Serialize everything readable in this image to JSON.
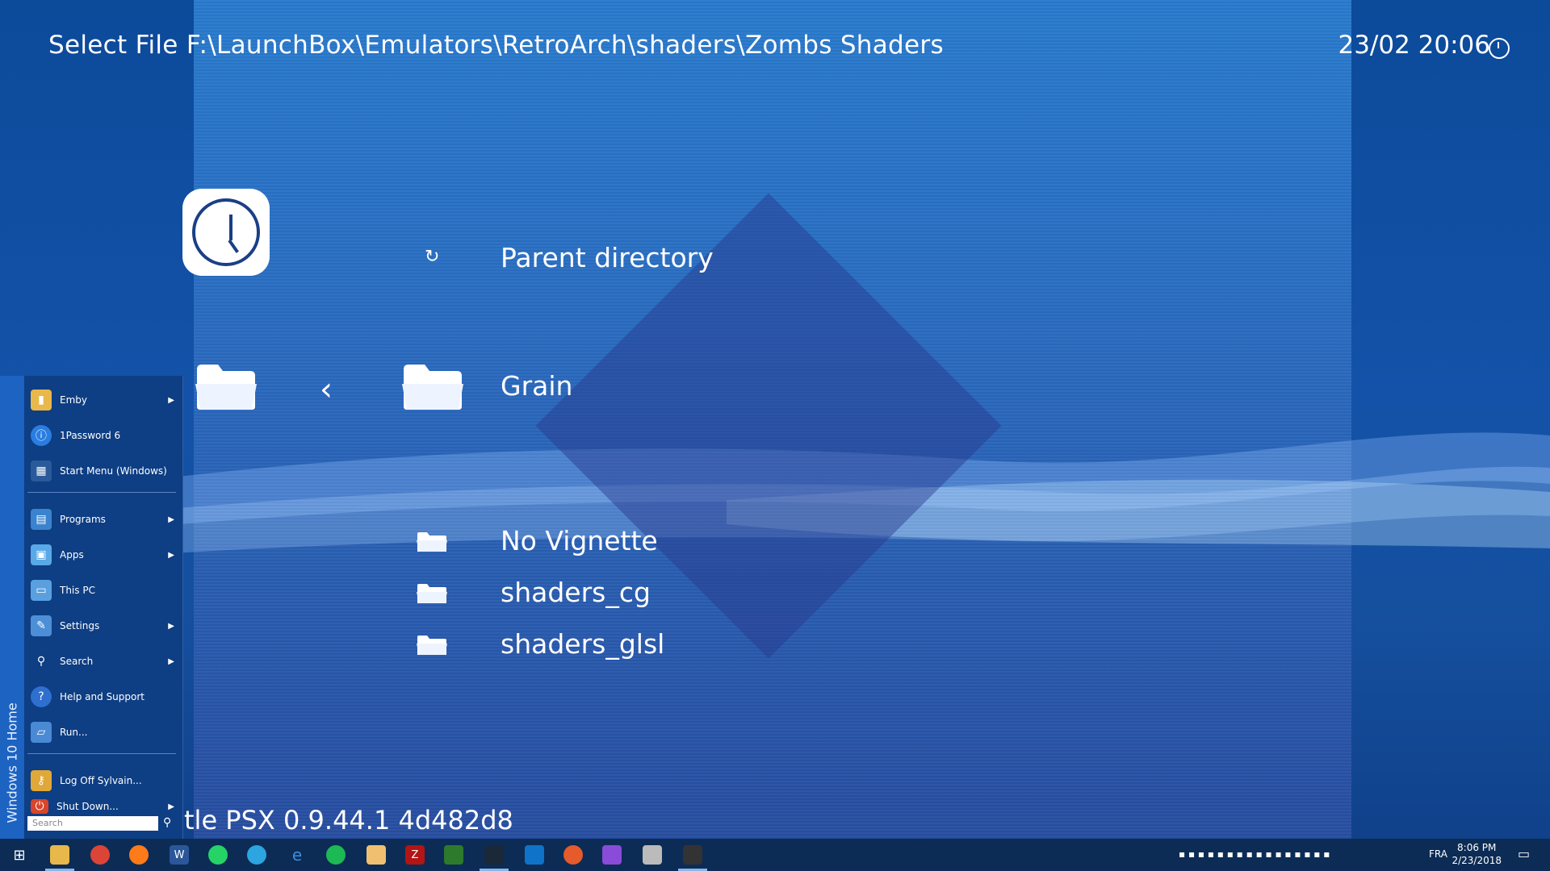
{
  "header": {
    "title": "Select File F:\\LaunchBox\\Emulators\\RetroArch\\shaders\\Zombs Shaders",
    "clock": "23/02 20:06"
  },
  "entries": {
    "parent": "Parent directory",
    "grain": "Grain",
    "no_vignette": "No Vignette",
    "shaders_cg": "shaders_cg",
    "shaders_glsl": "shaders_glsl"
  },
  "footer": {
    "core": "tle PSX 0.9.44.1 4d482d8"
  },
  "startmenu": {
    "stripe": "Windows 10 Home",
    "items": [
      "Emby",
      "1Password 6",
      "Start Menu (Windows)",
      "Programs",
      "Apps",
      "This PC",
      "Settings",
      "Search",
      "Help and Support",
      "Run...",
      "Log Off Sylvain...",
      "Shut Down..."
    ],
    "search_placeholder": "Search"
  },
  "taskbar": {
    "lang": "FRA",
    "time": "8:06 PM",
    "date": "2/23/2018"
  }
}
